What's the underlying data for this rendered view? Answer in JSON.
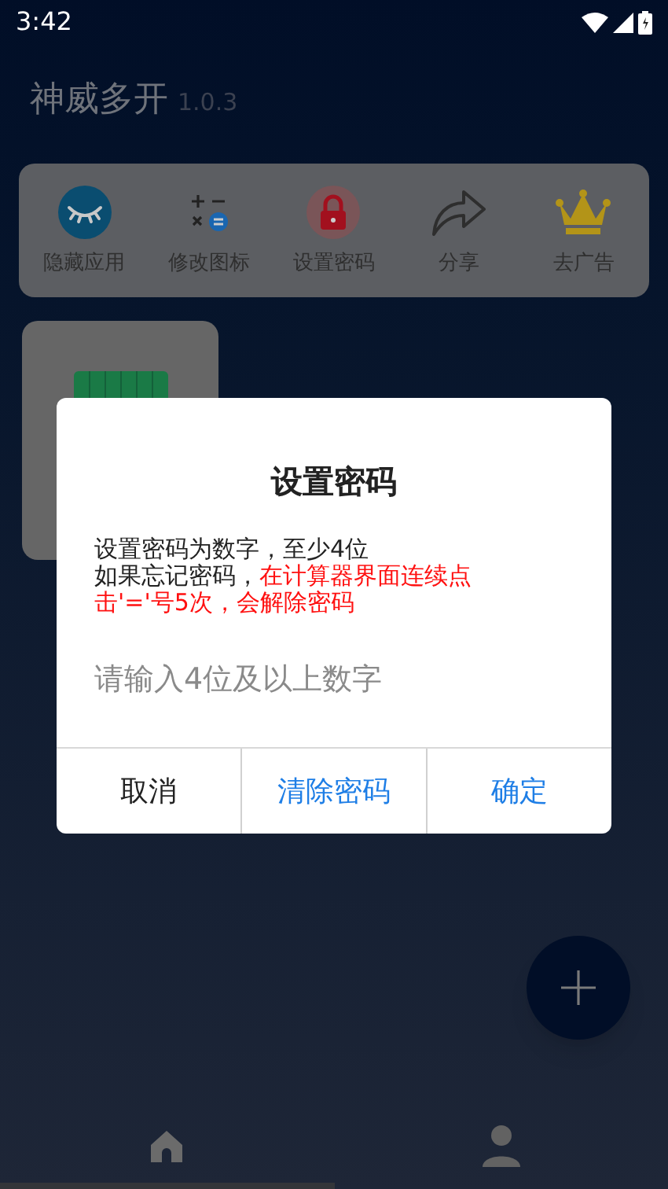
{
  "status_bar": {
    "time": "3:42"
  },
  "app_title": {
    "name": "神威多开",
    "version": "1.0.3"
  },
  "toolbar": [
    {
      "kind": "hide",
      "label": "隐藏应用"
    },
    {
      "kind": "icon",
      "label": "修改图标"
    },
    {
      "kind": "lock",
      "label": "设置密码"
    },
    {
      "kind": "share",
      "label": "分享"
    },
    {
      "kind": "ads",
      "label": "去广告"
    }
  ],
  "dialog": {
    "title": "设置密码",
    "note": "设置密码为数字，至少4位",
    "forgot": "如果忘记密码，",
    "warning": "在计算器界面连续点击'='号5次，会解除密码",
    "placeholder": "请输入4位及以上数字",
    "buttons": [
      {
        "label": "取消",
        "primary": false
      },
      {
        "label": "清除密码",
        "primary": true
      },
      {
        "label": "确定",
        "primary": true
      }
    ]
  },
  "bottom_nav": [
    {
      "kind": "home",
      "selected": true
    },
    {
      "kind": "profile",
      "selected": false
    }
  ]
}
